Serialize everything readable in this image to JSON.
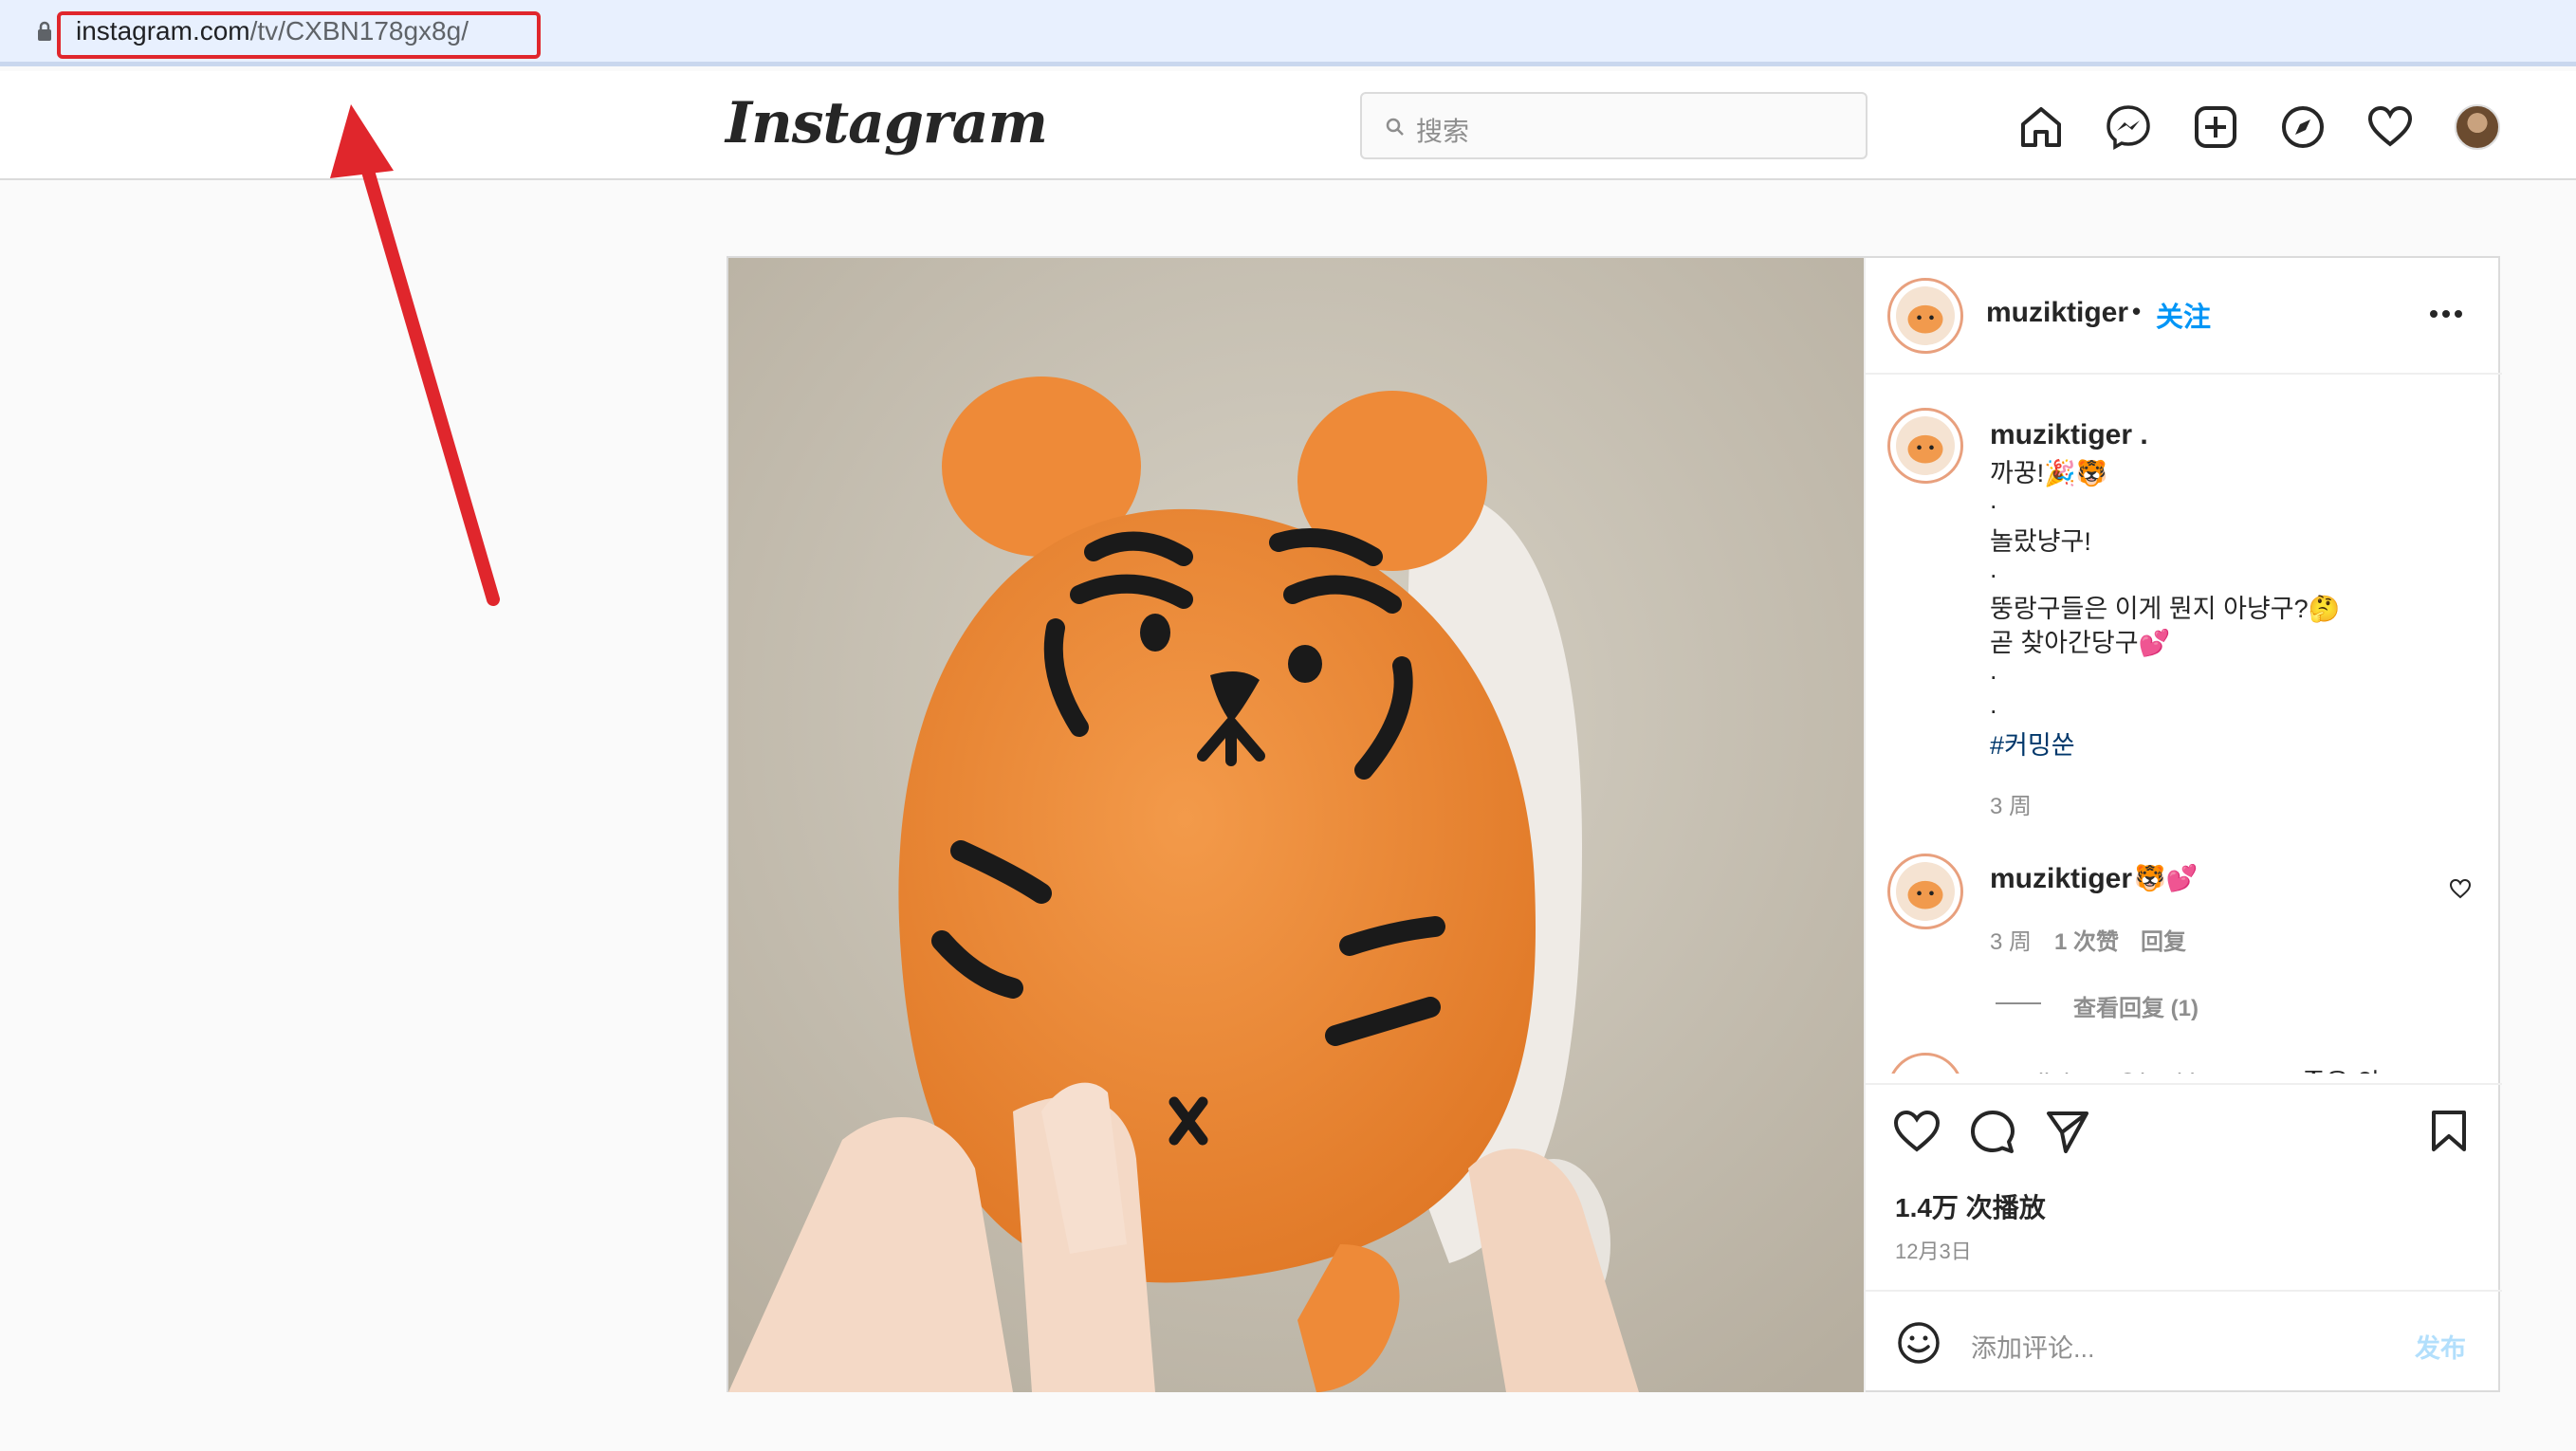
{
  "browser": {
    "url_host": "instagram.com",
    "url_path": "/tv/CXBN178gx8g/"
  },
  "header": {
    "logo": "Instagram",
    "search_placeholder": "搜索",
    "nav_icons": [
      "home-icon",
      "messenger-icon",
      "new-post-icon",
      "explore-icon",
      "activity-heart-icon",
      "profile-avatar"
    ]
  },
  "post": {
    "author": "muziktiger",
    "follow_label": "关注",
    "caption": {
      "author": "muziktiger .",
      "lines": [
        "까꿍!🎉🐯",
        ".",
        "놀랐냥구!",
        ".",
        "뚱랑구들은 이게 뭔지 아냥구?🤔",
        "곧 찾아간당구💕",
        ".",
        "."
      ],
      "hashtag": "#커밍쑨",
      "age": "3 周"
    },
    "comment": {
      "author": "muziktiger",
      "text": "🐯💕",
      "age": "3 周",
      "likes": "1 次赞",
      "reply": "回复",
      "view_replies": "查看回复 (1)"
    },
    "partial_comment": "muziktiger @horithemyung 좋은 의",
    "plays": "1.4万 次播放",
    "date": "12月3日",
    "add_comment_placeholder": "添加评论...",
    "post_button": "发布"
  },
  "colors": {
    "accent": "#0095f6",
    "annotation": "#e0262c"
  }
}
